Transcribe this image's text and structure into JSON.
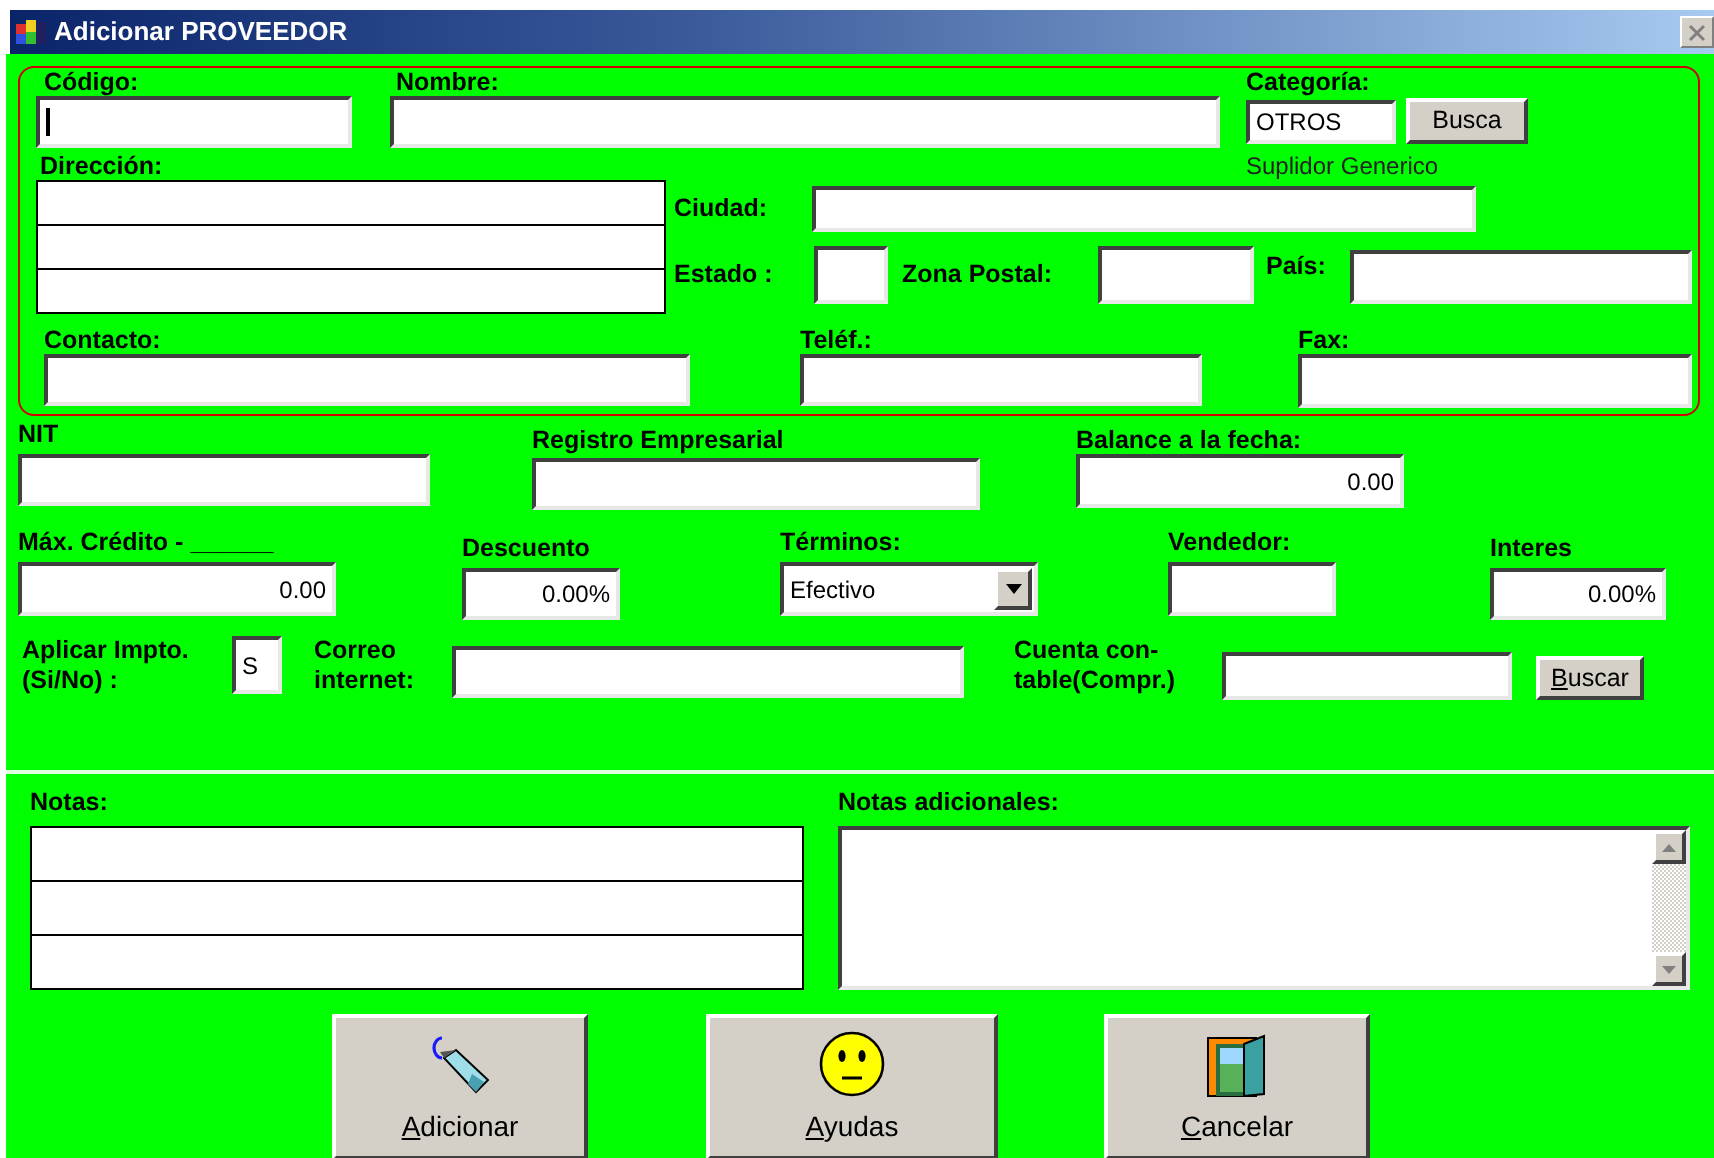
{
  "window": {
    "title": "Adicionar PROVEEDOR"
  },
  "codigo": {
    "label": "Código:",
    "focused": true
  },
  "nombre": {
    "label": "Nombre:"
  },
  "categoria": {
    "label": "Categoría:",
    "value": "OTROS",
    "button": {
      "label": "Busca"
    },
    "description": "Suplidor Generico"
  },
  "direccion": {
    "label": "Dirección:"
  },
  "ciudad": {
    "label": "Ciudad:"
  },
  "estado": {
    "label": "Estado :"
  },
  "zona_postal": {
    "label": "Zona Postal:"
  },
  "pais": {
    "label": "País:"
  },
  "contacto": {
    "label": "Contacto:"
  },
  "telefono": {
    "label": "Teléf.:"
  },
  "fax": {
    "label": "Fax:"
  },
  "nit": {
    "label": "NIT"
  },
  "registro_empresarial": {
    "label": "Registro Empresarial"
  },
  "balance": {
    "label": "Balance a la fecha:",
    "value": "0.00"
  },
  "max_credito": {
    "label": "Máx. Crédito - ______",
    "value": "0.00"
  },
  "descuento": {
    "label": "Descuento",
    "value": "0.00%"
  },
  "terminos": {
    "label": "Términos:",
    "value": "Efectivo"
  },
  "vendedor": {
    "label": "Vendedor:"
  },
  "interes": {
    "label": "Interes",
    "value": "0.00%"
  },
  "aplicar_impto": {
    "label_lines": [
      "Aplicar Impto.",
      "(Si/No) :"
    ],
    "value": "S"
  },
  "correo": {
    "label_lines": [
      "Correo",
      "internet:"
    ]
  },
  "cuenta_contable": {
    "label_lines": [
      "Cuenta con-",
      "table(Compr.)"
    ],
    "button": {
      "mnemonic": "B",
      "rest": "uscar"
    }
  },
  "notas": {
    "label": "Notas:"
  },
  "notas_adicionales": {
    "label": "Notas adicionales:"
  },
  "buttons": [
    {
      "kind": "add",
      "mnemonic": "A",
      "rest": "dicionar"
    },
    {
      "kind": "help",
      "mnemonic": "A",
      "rest": "yudas"
    },
    {
      "kind": "cancel",
      "mnemonic": "C",
      "rest": "ancelar"
    }
  ]
}
